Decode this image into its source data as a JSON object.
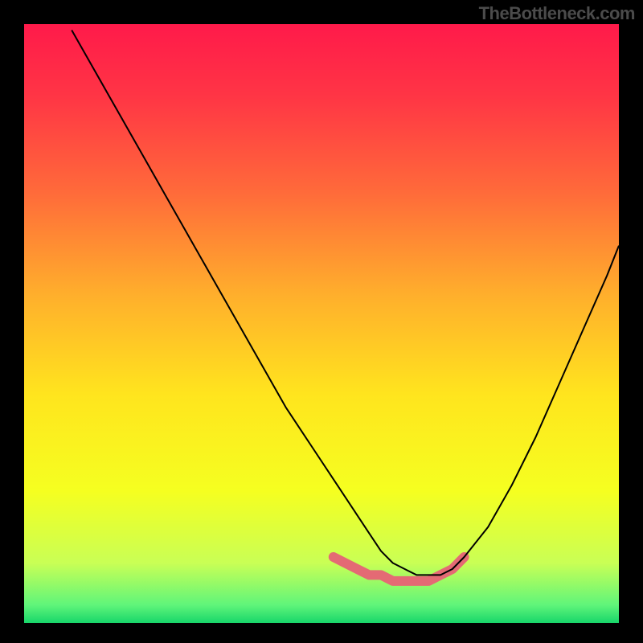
{
  "attribution": "TheBottleneck.com",
  "chart_data": {
    "type": "line",
    "title": "",
    "xlabel": "",
    "ylabel": "",
    "xlim": [
      0,
      100
    ],
    "ylim": [
      0,
      100
    ],
    "grid": false,
    "legend": false,
    "background_gradient": {
      "stops": [
        {
          "offset": 0.0,
          "color": "#ff1a4a"
        },
        {
          "offset": 0.12,
          "color": "#ff3545"
        },
        {
          "offset": 0.28,
          "color": "#ff6a3a"
        },
        {
          "offset": 0.45,
          "color": "#ffae2c"
        },
        {
          "offset": 0.62,
          "color": "#ffe51e"
        },
        {
          "offset": 0.78,
          "color": "#f5ff20"
        },
        {
          "offset": 0.9,
          "color": "#c9ff55"
        },
        {
          "offset": 0.97,
          "color": "#60f57a"
        },
        {
          "offset": 1.0,
          "color": "#18d66a"
        }
      ]
    },
    "series": [
      {
        "name": "bottleneck-curve",
        "color": "#000000",
        "width": 2,
        "x": [
          8,
          12,
          16,
          20,
          24,
          28,
          32,
          36,
          40,
          44,
          48,
          52,
          56,
          58,
          60,
          62,
          64,
          66,
          68,
          70,
          72,
          74,
          78,
          82,
          86,
          90,
          94,
          98,
          100
        ],
        "y": [
          99,
          92,
          85,
          78,
          71,
          64,
          57,
          50,
          43,
          36,
          30,
          24,
          18,
          15,
          12,
          10,
          9,
          8,
          8,
          8,
          9,
          11,
          16,
          23,
          31,
          40,
          49,
          58,
          63
        ]
      },
      {
        "name": "optimal-range-marker",
        "color": "#e46a74",
        "width": 12,
        "linecap": "round",
        "x": [
          52,
          54,
          56,
          58,
          60,
          62,
          64,
          66,
          68,
          70,
          72,
          74
        ],
        "y": [
          11,
          10,
          9,
          8,
          8,
          7,
          7,
          7,
          7,
          8,
          9,
          11
        ]
      }
    ]
  }
}
